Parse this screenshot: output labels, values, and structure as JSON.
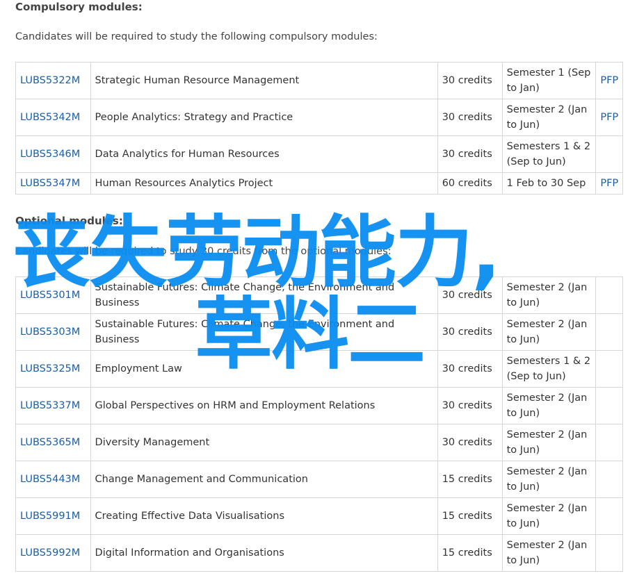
{
  "compulsory": {
    "heading": "Compulsory modules:",
    "intro": "Candidates will be required to study the following compulsory modules:",
    "rows": [
      {
        "code": "LUBS5322M",
        "title": "Strategic Human Resource Management",
        "credits": "30 credits",
        "semester": "Semester 1 (Sep to Jan)",
        "pfp": "PFP"
      },
      {
        "code": "LUBS5342M",
        "title": "People Analytics: Strategy and Practice",
        "credits": "30 credits",
        "semester": "Semester 2 (Jan to Jun)",
        "pfp": "PFP"
      },
      {
        "code": "LUBS5346M",
        "title": "Data Analytics for Human Resources",
        "credits": "30 credits",
        "semester": "Semesters 1 & 2 (Sep to Jun)",
        "pfp": ""
      },
      {
        "code": "LUBS5347M",
        "title": "Human Resources Analytics Project",
        "credits": "60 credits",
        "semester": "1 Feb to 30 Sep",
        "pfp": "PFP"
      }
    ]
  },
  "optional": {
    "heading": "Optional modules:",
    "intro": "Candidates will be required to study 30 credits from the optional modules:",
    "rows": [
      {
        "code": "LUBS5301M",
        "title": "Sustainable Futures: Climate Change, the Environment and Business",
        "credits": "30 credits",
        "semester": "Semester 2 (Jan to Jun)",
        "pfp": ""
      },
      {
        "code": "LUBS5303M",
        "title": "Sustainable Futures: Climate Change, the Environment and Business",
        "credits": "30 credits",
        "semester": "Semester 2 (Jan to Jun)",
        "pfp": ""
      },
      {
        "code": "LUBS5325M",
        "title": "Employment Law",
        "credits": "30 credits",
        "semester": "Semesters 1 & 2 (Sep to Jun)",
        "pfp": ""
      },
      {
        "code": "LUBS5337M",
        "title": "Global Perspectives on HRM and Employment Relations",
        "credits": "30 credits",
        "semester": "Semester 2 (Jan to Jun)",
        "pfp": ""
      },
      {
        "code": "LUBS5365M",
        "title": "Diversity Management",
        "credits": "30 credits",
        "semester": "Semester 2 (Jan to Jun)",
        "pfp": ""
      },
      {
        "code": "LUBS5443M",
        "title": "Change Management and Communication",
        "credits": "15 credits",
        "semester": "Semester 2 (Jan to Jun)",
        "pfp": ""
      },
      {
        "code": "LUBS5991M",
        "title": "Creating Effective Data Visualisations",
        "credits": "15 credits",
        "semester": "Semester 2 (Jan to Jun)",
        "pfp": ""
      },
      {
        "code": "LUBS5992M",
        "title": "Digital Information and Organisations",
        "credits": "15 credits",
        "semester": "Semester 2 (Jan to Jun)",
        "pfp": ""
      }
    ]
  },
  "overlay": {
    "line1": "丧失劳动能力,",
    "line2": "草料二"
  },
  "colors": {
    "link": "#1a5ea8",
    "overlay": "#0a8cf0",
    "border": "#d6d6d6"
  }
}
